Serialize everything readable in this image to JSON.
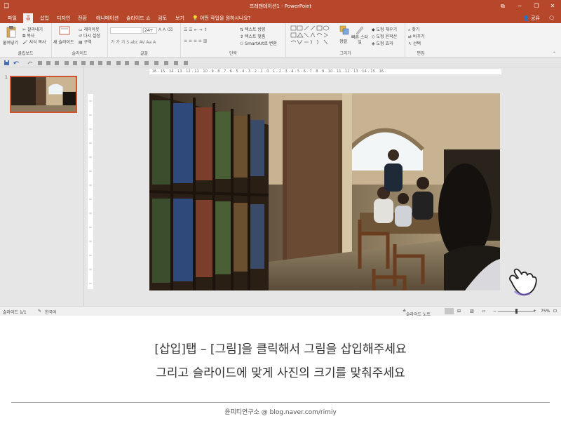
{
  "window": {
    "title": "프레젠테이션1 - PowerPoint",
    "btn_restore": "⧉",
    "btn_minimize": "−",
    "btn_maximize": "❐",
    "btn_close": "✕"
  },
  "tabs": [
    "파일",
    "홈",
    "삽입",
    "디자인",
    "전환",
    "애니메이션",
    "슬라이드 쇼",
    "검토",
    "보기"
  ],
  "active_tab": "홈",
  "tell_me": "어떤 작업을 원하시나요?",
  "share": "공유",
  "ribbon": {
    "clipboard": {
      "label": "클립보드",
      "paste": "붙여넣기",
      "cut": "잘라내기",
      "copy": "복사",
      "format_painter": "서식 복사"
    },
    "slides": {
      "label": "슬라이드",
      "new_slide": "새 슬라이드",
      "layout": "레이아웃",
      "reset": "다시 설정",
      "section": "구역"
    },
    "font": {
      "label": "글꼴",
      "size": "24+"
    },
    "paragraph": {
      "label": "단락",
      "text_direction": "텍스트 방향",
      "align_text": "텍스트 맞춤",
      "smartart": "SmartArt로 변환"
    },
    "drawing": {
      "label": "그리기",
      "arrange": "정렬",
      "quick_styles": "빠른 스타일",
      "fill": "도형 채우기",
      "outline": "도형 윤곽선",
      "effects": "도형 효과"
    },
    "editing": {
      "label": "편집",
      "find": "찾기",
      "replace": "바꾸기",
      "select": "선택"
    }
  },
  "ruler": {
    "horizontal_text": "· 16 · 15 · 14 · 13 · 12 · 11 · 10 · 9 · 8 · 7 · 6 · 5 · 4 · 3 · 2 · 1 · 0 · 1 · 2 · 3 · 4 · 5 · 6 · 7 · 8 · 9 · 10 · 11 · 12 · 13 · 14 · 15 · 16 ·"
  },
  "slide_panel": {
    "slide_number": "1"
  },
  "status": {
    "slide_info": "슬라이드 1/1",
    "language": "한국어",
    "notes": "슬라이드 노트",
    "zoom": "75%"
  },
  "caption": {
    "line1": "[삽입]탭 – [그림]을 클릭해서 그림을 삽입해주세요",
    "line2": "그리고 슬라이드에 맞게 사진의 크기를 맞춰주세요",
    "credit": "윤피티연구소 @ blog.naver.com/rimiy"
  },
  "colors": {
    "accent": "#b7472a",
    "ribbon_bg": "#f3f3f3",
    "workspace_bg": "#e6e6e6",
    "thumb_border": "#d35230"
  }
}
